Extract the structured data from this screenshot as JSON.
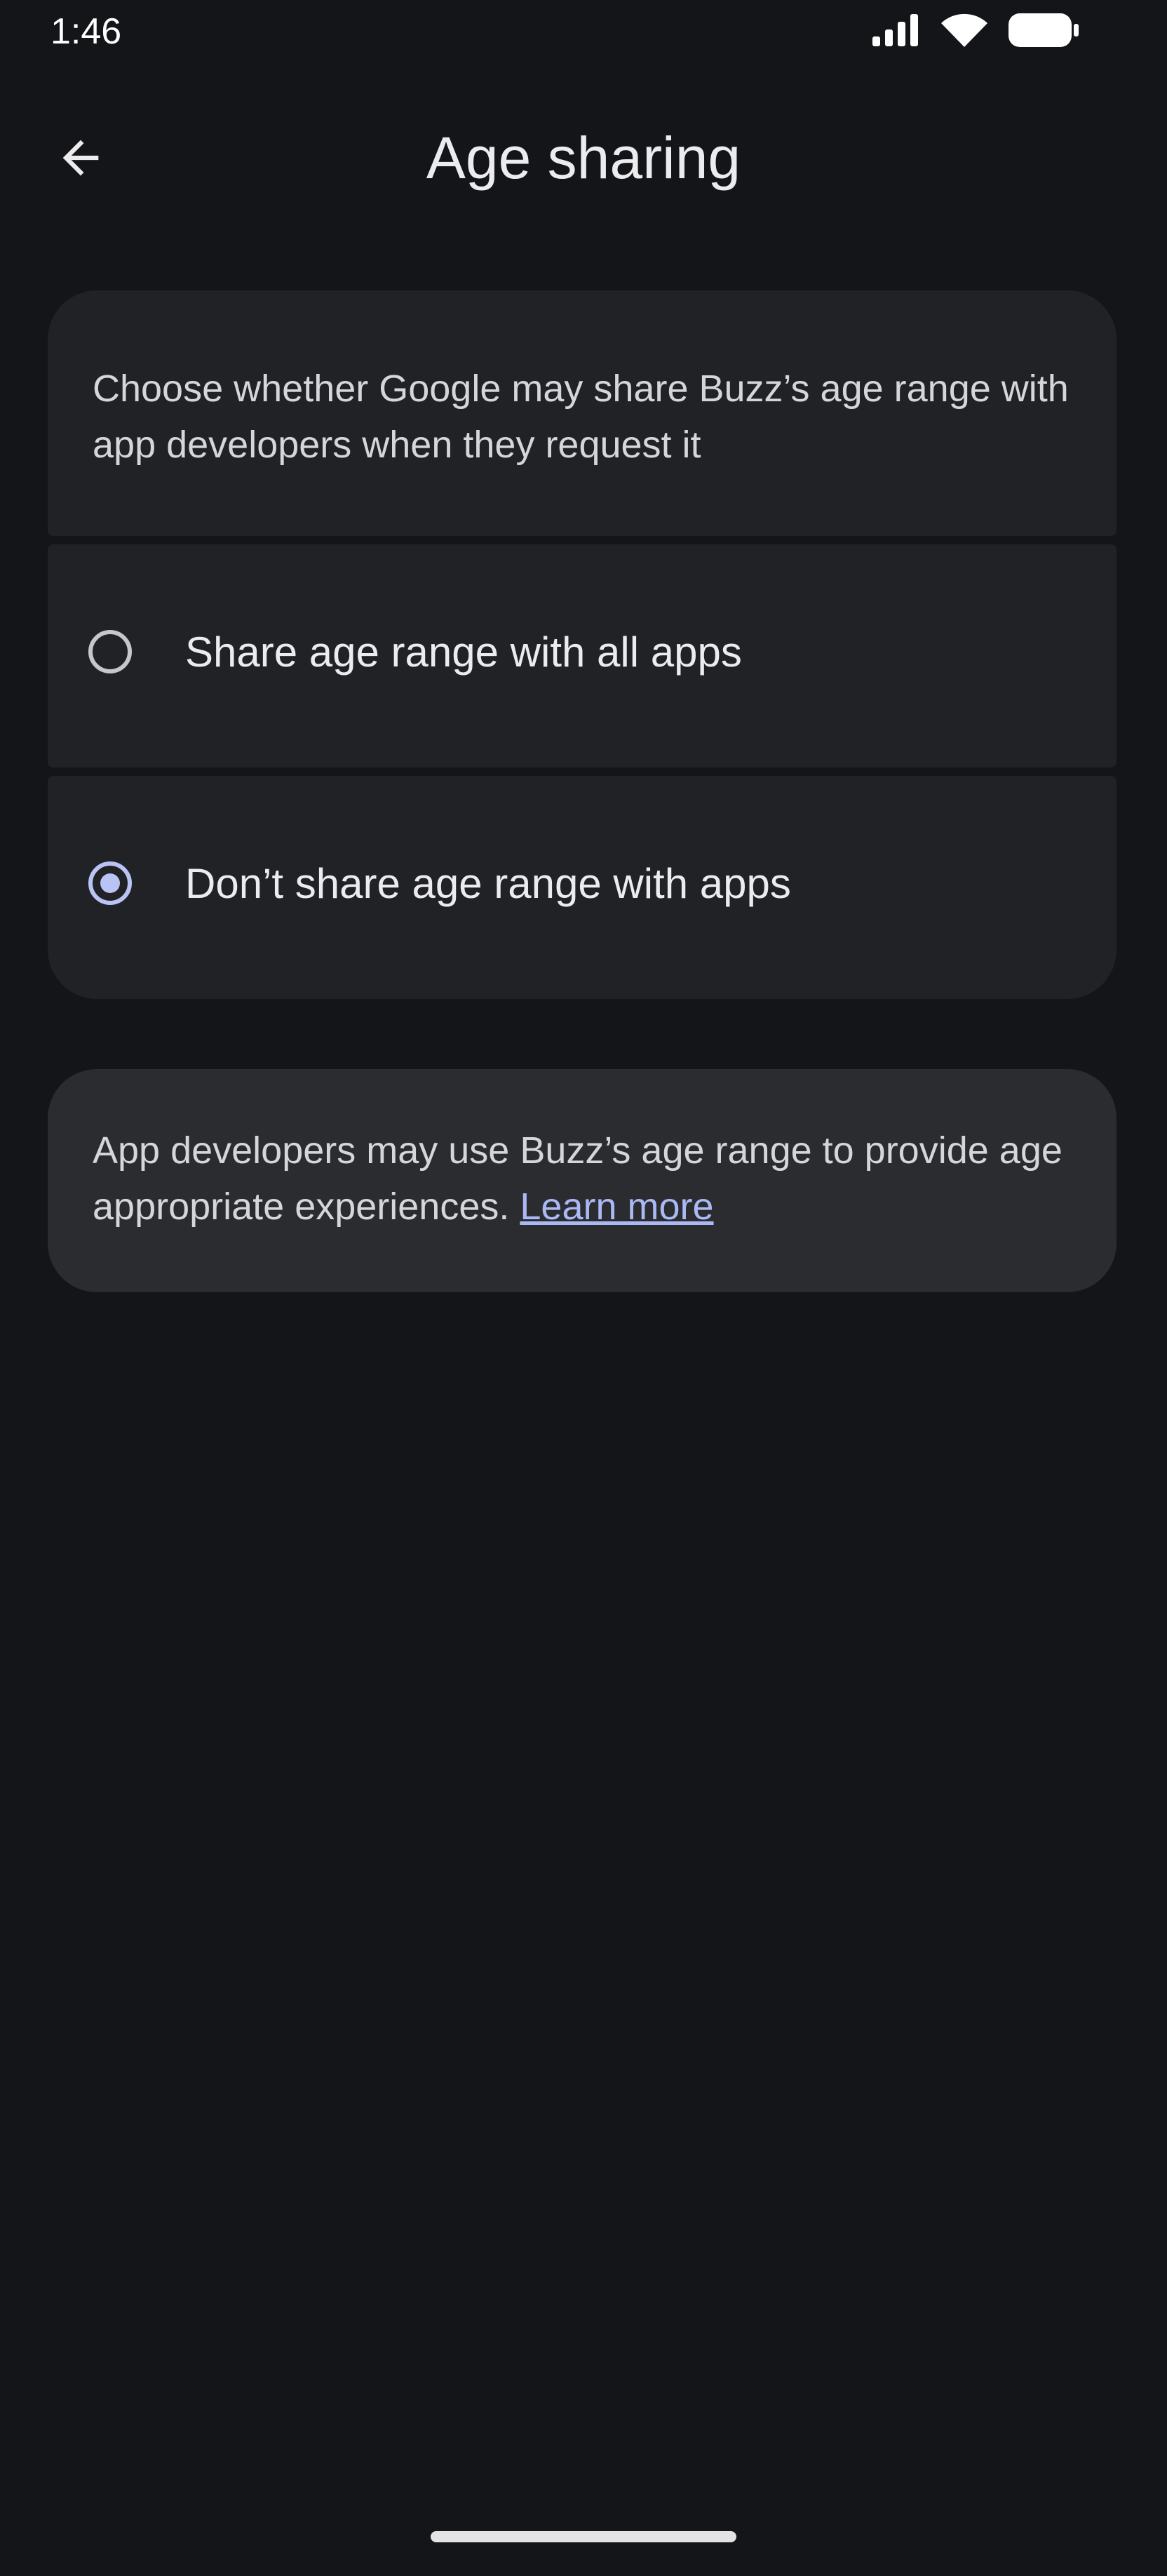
{
  "status_bar": {
    "time": "1:46",
    "icons": [
      "signal-icon",
      "wifi-icon",
      "battery-icon"
    ]
  },
  "app_bar": {
    "back_icon": "arrow-left-icon",
    "title": "Age sharing"
  },
  "description": {
    "text": "Choose whether Google may share Buzz’s age range with app developers when they request it"
  },
  "options": [
    {
      "label": "Share age range with all apps",
      "selected": false
    },
    {
      "label": "Don’t share age range with apps",
      "selected": true
    }
  ],
  "info": {
    "text": "App developers may use Buzz’s age range to provide age appropriate experiences.",
    "link_label": "Learn more"
  },
  "colors": {
    "background": "#141518",
    "card": "#212226",
    "info_card": "#2b2c30",
    "accent": "#b9c4f5",
    "link": "#aab8f3"
  }
}
